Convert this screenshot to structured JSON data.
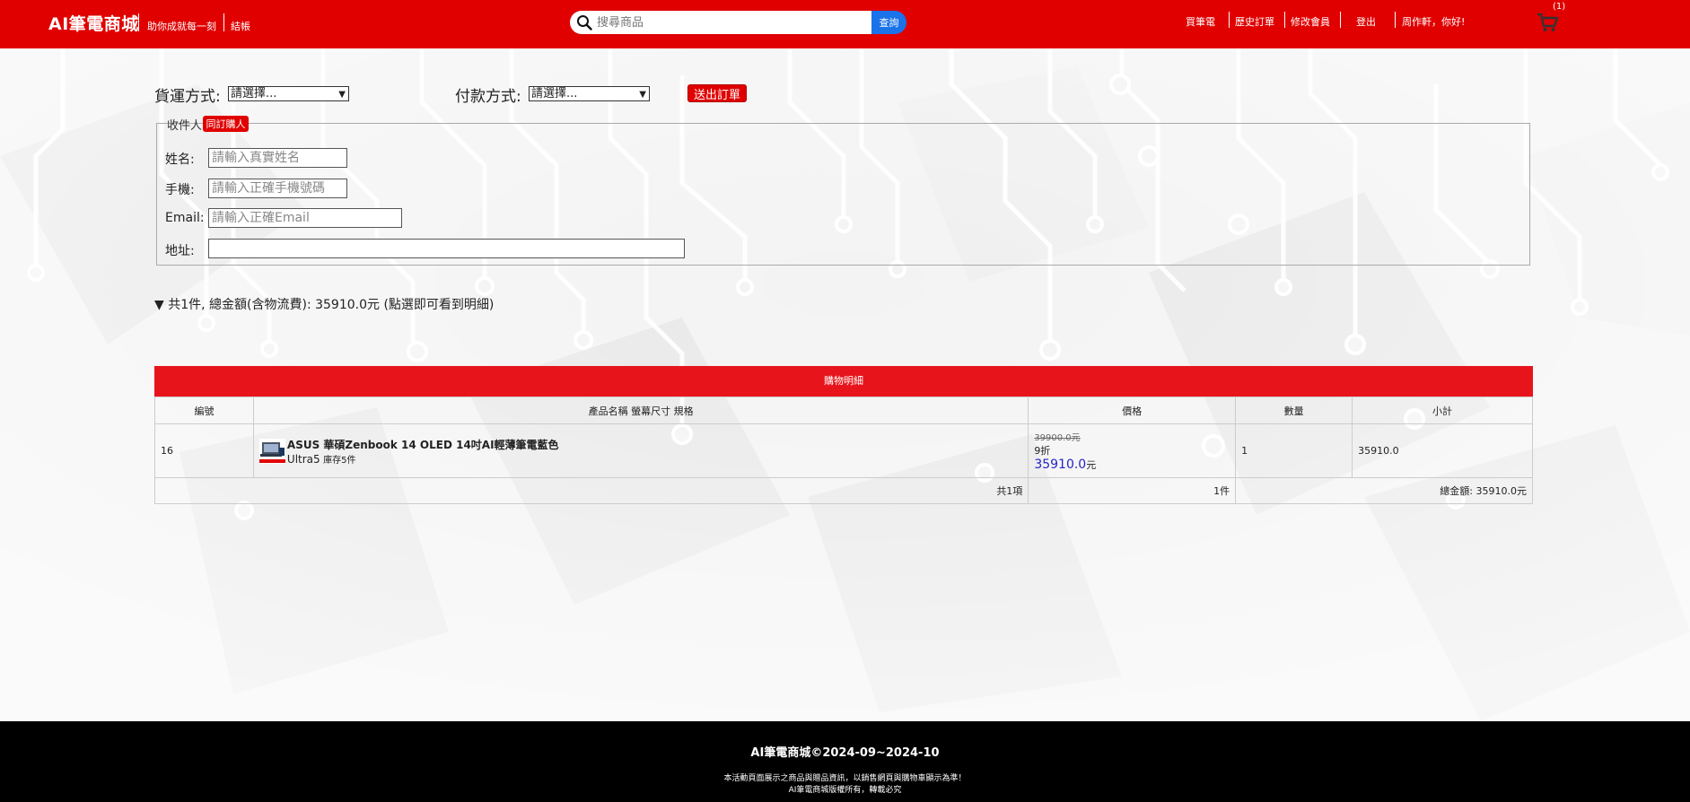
{
  "header": {
    "brand": "AI筆電商城",
    "slogan": "助你成就每一刻",
    "checkout": "結帳",
    "search_placeholder": "搜尋商品",
    "search_button": "查詢",
    "nav": [
      "買筆電",
      "歷史訂單",
      "修改會員",
      "登出",
      "周作軒，你好!"
    ],
    "cart_count": "(1)",
    "icons": {
      "search": "search-icon",
      "cart": "cart-icon"
    },
    "colors": {
      "brand_red": "#e00000",
      "search_blue": "#1a73e8"
    }
  },
  "order_form": {
    "shipping_label": "貨運方式:",
    "shipping_selected": "請選擇...",
    "payment_label": "付款方式:",
    "payment_selected": "請選擇...",
    "submit_label": "送出訂單",
    "recipient_legend": "收件人",
    "same_as_buyer": "同訂購人",
    "fields": {
      "name": {
        "label": "姓名:",
        "placeholder": "請輸入真實姓名"
      },
      "phone": {
        "label": "手機:",
        "placeholder": "請輸入正確手機號碼"
      },
      "email": {
        "label": "Email:",
        "placeholder": "請輸入正確Email"
      },
      "address": {
        "label": "地址:",
        "placeholder": ""
      }
    }
  },
  "summary": "▼ 共1件, 總金額(含物流費): 35910.0元 (點選即可看到明細)",
  "cart_table": {
    "title": "購物明細",
    "headers": [
      "編號",
      "產品名稱 螢幕尺寸 規格",
      "價格",
      "數量",
      "小計"
    ],
    "row": {
      "id": "16",
      "product_name": "ASUS 華碩Zenbook 14 OLED 14吋AI輕薄筆電藍色",
      "spec": "Ultra5",
      "stock": "庫存5件",
      "original_price": "39900.0元",
      "discount": "9折",
      "price": "35910.0",
      "price_unit": "元",
      "quantity": "1",
      "subtotal": "35910.0"
    },
    "footer": {
      "items": "共1項",
      "count": "1件",
      "total": "總金額: 35910.0元"
    }
  },
  "footer": {
    "title": "AI筆電商城©2024-09~2024-10",
    "note1": "本活動頁面展示之商品與贈品資訊，以銷售網頁與購物車顯示為準！",
    "note2": "AI筆電商城版權所有，轉載必究"
  }
}
